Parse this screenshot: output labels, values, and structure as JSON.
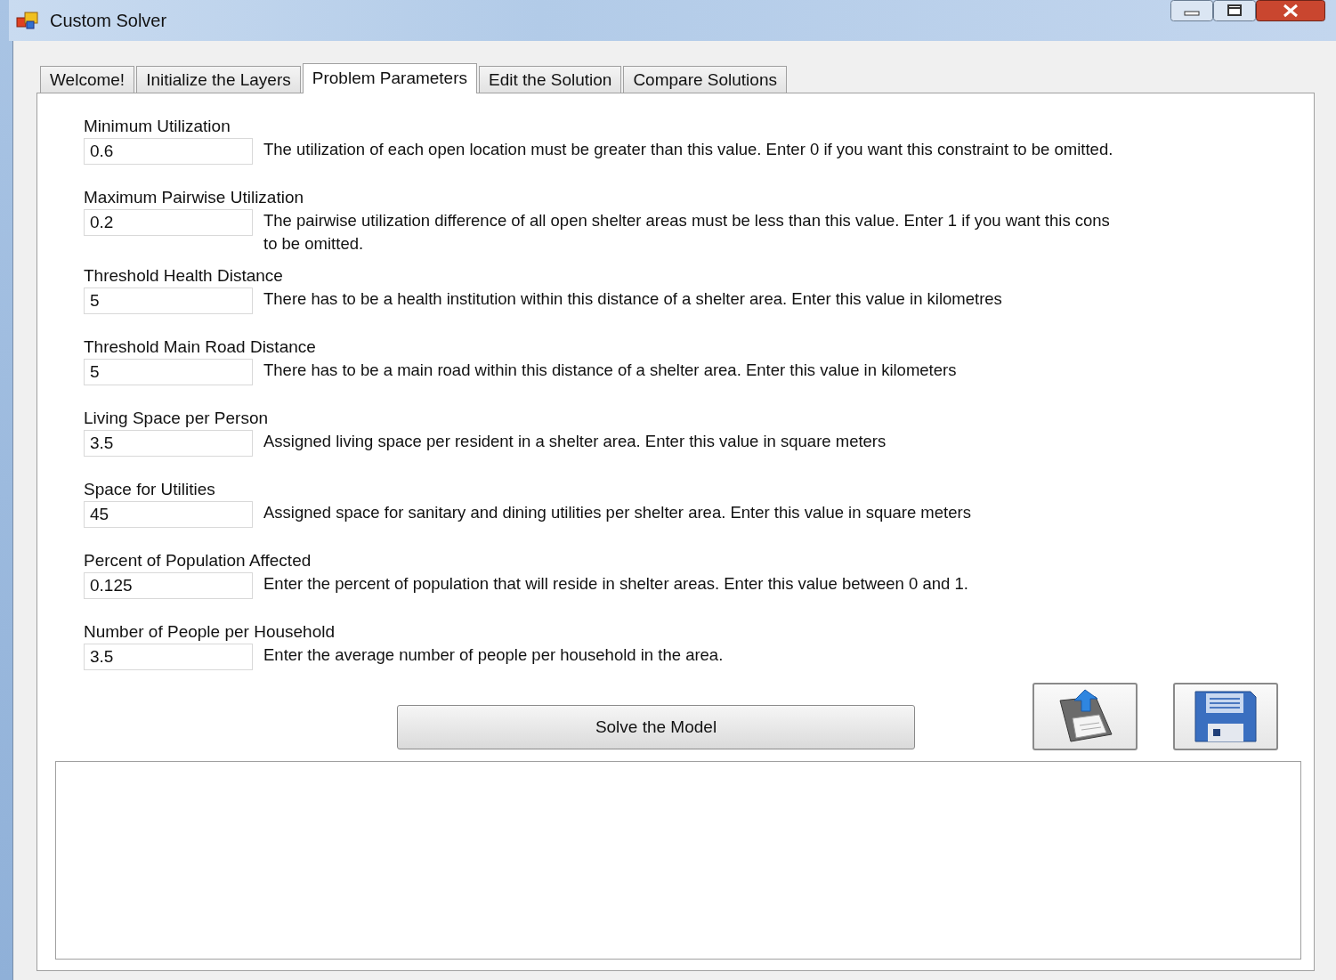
{
  "window": {
    "title": "Custom Solver"
  },
  "tabs": [
    {
      "label": "Welcome!",
      "selected": false
    },
    {
      "label": "Initialize the Layers",
      "selected": false
    },
    {
      "label": "Problem Parameters",
      "selected": true
    },
    {
      "label": "Edit the Solution",
      "selected": false
    },
    {
      "label": "Compare Solutions",
      "selected": false
    }
  ],
  "parameters": [
    {
      "label": "Minimum Utilization",
      "value": "0.6",
      "description": [
        "The utilization of each open location must be greater than this value. Enter 0 if you want this constraint to be omitted."
      ]
    },
    {
      "label": "Maximum Pairwise Utilization",
      "value": "0.2",
      "description": [
        "The pairwise utilization difference of all open shelter areas must be less than this value. Enter 1 if you want this cons",
        "to be omitted."
      ]
    },
    {
      "label": "Threshold Health Distance",
      "value": "5",
      "description": [
        "There has to be a health institution within this distance of a shelter area. Enter this value in kilometres"
      ]
    },
    {
      "label": "Threshold Main Road Distance",
      "value": "5",
      "description": [
        "There has to be a main road within this distance of a shelter area. Enter this value in kilometers"
      ]
    },
    {
      "label": "Living Space per Person",
      "value": "3.5",
      "description": [
        "Assigned living space per resident in a shelter area. Enter this value in square meters"
      ]
    },
    {
      "label": "Space for Utilities",
      "value": "45",
      "description": [
        "Assigned space for sanitary and dining utilities per shelter area. Enter this value in square meters"
      ]
    },
    {
      "label": "Percent of Population Affected",
      "value": "0.125",
      "description": [
        "Enter the percent of population that will reside in shelter areas. Enter this value between 0 and 1."
      ]
    },
    {
      "label": "Number of People per Household",
      "value": "3.5",
      "description": [
        "Enter the average number of people per household in the area."
      ]
    }
  ],
  "solve_button": "Solve the Model"
}
